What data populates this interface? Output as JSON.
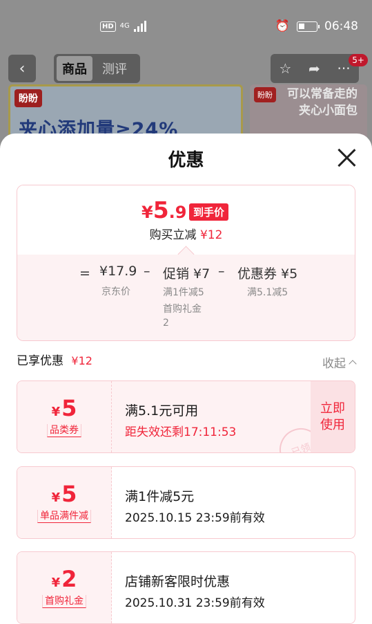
{
  "status_bar": {
    "hd": "HD",
    "network": "4G",
    "time": "06:48"
  },
  "nav": {
    "back_icon": "chevron-left-icon",
    "tabs": [
      {
        "label": "商品",
        "active": true
      },
      {
        "label": "测评",
        "active": false
      }
    ],
    "actions": [
      "star-icon",
      "share-icon",
      "more-icon"
    ],
    "badge": "5+"
  },
  "banner": {
    "logo": "盼盼",
    "text": "夹心添加量≥24%"
  },
  "banner2": {
    "logo": "盼盼",
    "text_line1": "可以常备走的",
    "text_line2": "夹心小面包"
  },
  "sheet": {
    "title": "优惠",
    "close_icon": "close-icon"
  },
  "price": {
    "yen": "¥",
    "int": "5",
    "dec": ".9",
    "tag": "到手价",
    "instant_label": "购买立减",
    "instant_amount": "¥12",
    "equals": "=",
    "base_price": "¥17.9",
    "base_label": "京东价",
    "minus1": "–",
    "promo": "促销 ¥7",
    "promo_detail1": "满1件减5",
    "promo_detail2": "首购礼金",
    "promo_detail3": "2",
    "minus2": "–",
    "coupon": "优惠券 ¥5",
    "coupon_detail": "满5.1减5"
  },
  "enjoyed": {
    "label": "已享优惠",
    "amount": "¥12",
    "collapse": "收起"
  },
  "coupons": [
    {
      "yen": "¥",
      "value": "5",
      "type": "品类券",
      "title": "满5.1元可用",
      "sub": "距失效还剩17:11:53",
      "button": "立即使用",
      "stamp": "已领"
    },
    {
      "yen": "¥",
      "value": "5",
      "type": "单品满件减",
      "title": "满1件减5元",
      "sub": "2025.10.15 23:59前有效"
    },
    {
      "yen": "¥",
      "value": "2",
      "type": "首购礼金",
      "title": "店铺新客限时优惠",
      "sub": "2025.10.31 23:59前有效"
    }
  ],
  "colors": {
    "accent": "#f0253a",
    "coupon_bg": "#fef2f3",
    "coupon_border": "#f7c9cf"
  }
}
